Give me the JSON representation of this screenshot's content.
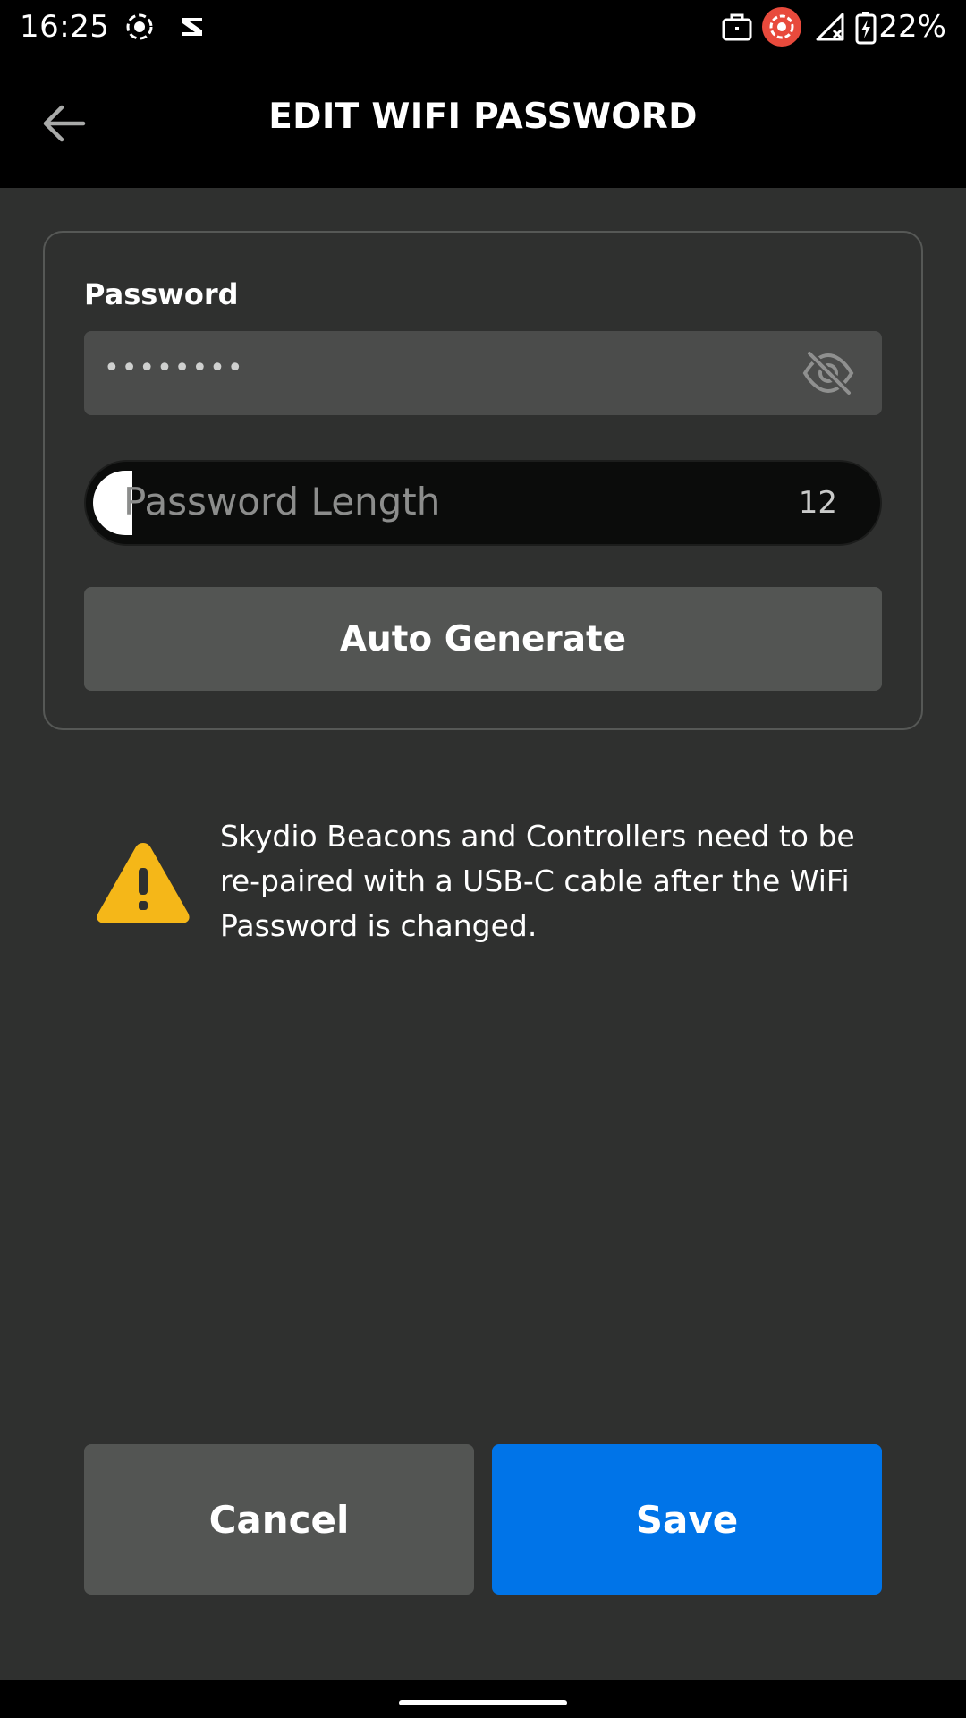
{
  "status_bar": {
    "time": "16:25",
    "battery_percent": "22%",
    "icons": [
      "record-icon",
      "notification-icon",
      "briefcase-icon",
      "screen-record-icon",
      "no-signal-icon",
      "battery-charging-icon"
    ],
    "record_color": "#e84a3c"
  },
  "app_bar": {
    "title": "EDIT WIFI PASSWORD",
    "back_icon": "arrow-left-icon"
  },
  "password": {
    "label": "Password",
    "value": "••••••••",
    "visibility_icon": "eye-off-icon"
  },
  "length_slider": {
    "label": "Password Length",
    "value": "12",
    "fill_fraction": 0.05
  },
  "auto_generate": {
    "label": "Auto Generate"
  },
  "warning": {
    "icon": "warning-icon",
    "icon_color": "#f5b718",
    "text": "Skydio Beacons and Controllers need to be re-paired with a USB-C cable after the WiFi Password is changed."
  },
  "actions": {
    "cancel_label": "Cancel",
    "save_label": "Save",
    "save_color": "#0074e8"
  }
}
